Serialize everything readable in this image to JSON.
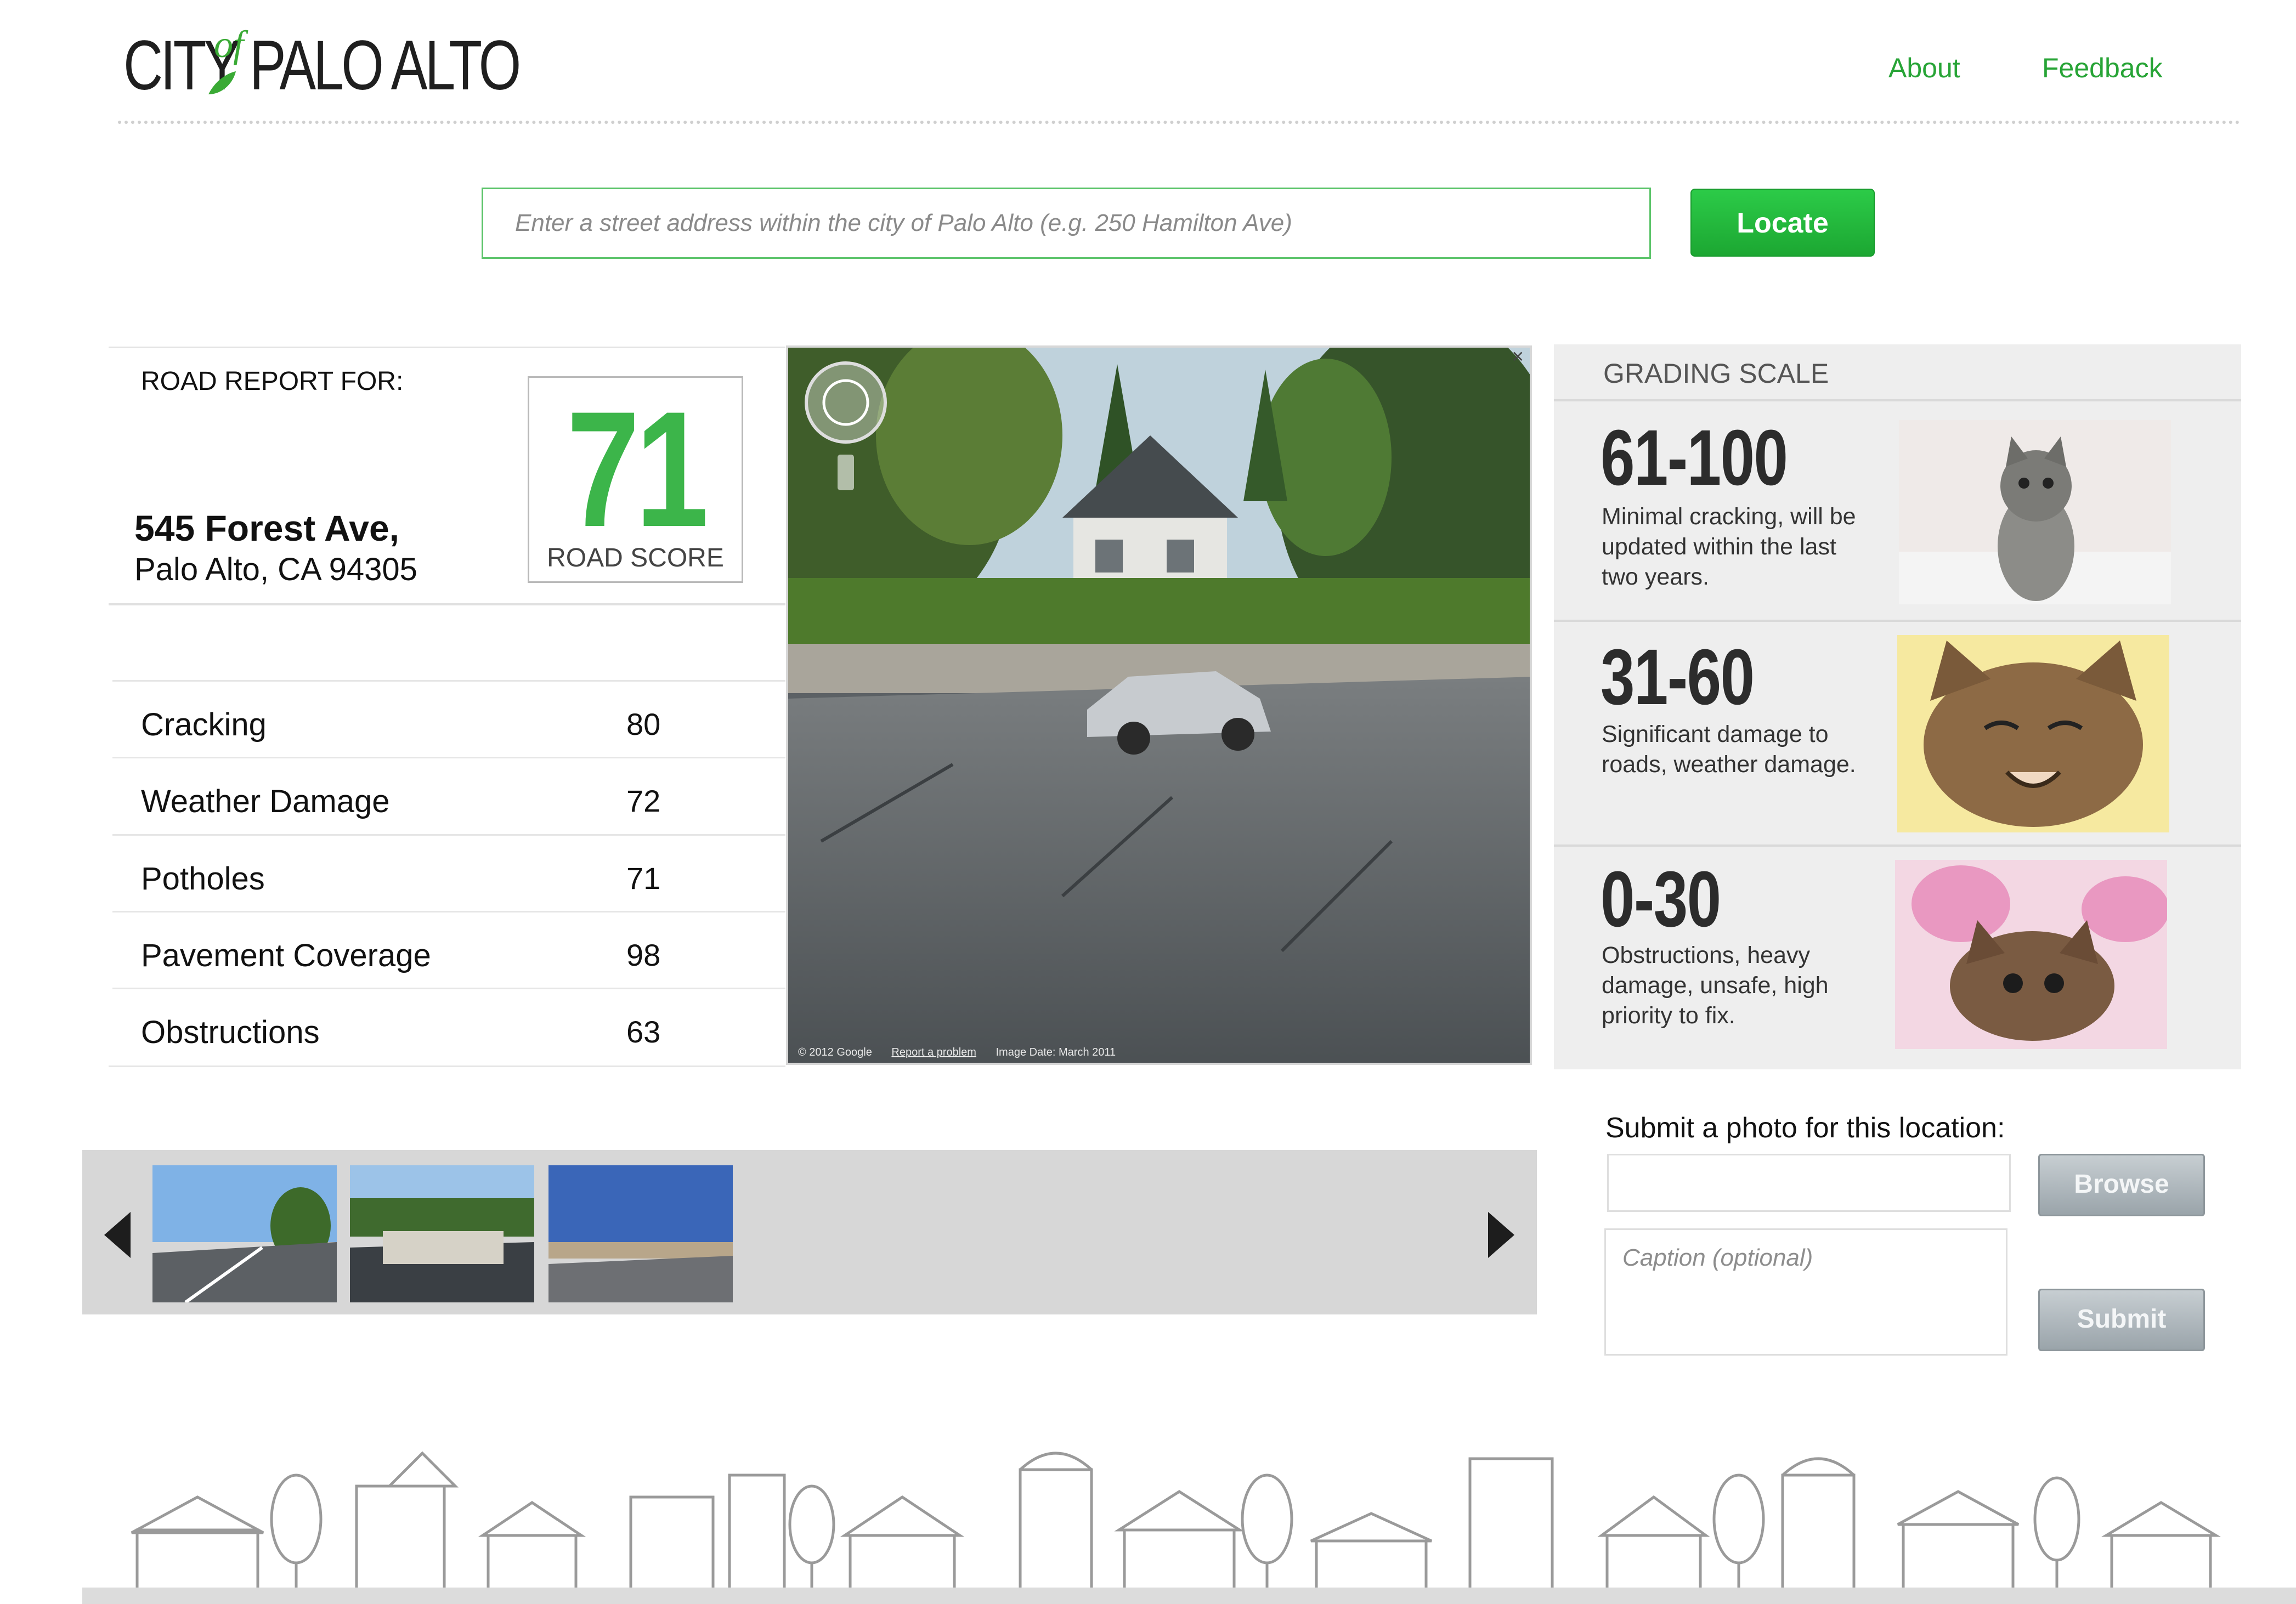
{
  "header": {
    "logo_text": "CITY of PALO ALTO",
    "logo_word_left": "CITY",
    "logo_word_of": "of",
    "logo_word_right": "PALO ALTO",
    "nav": {
      "about": "About",
      "feedback": "Feedback"
    }
  },
  "search": {
    "placeholder": "Enter a street address within the city of Palo Alto (e.g. 250 Hamilton Ave)",
    "button_label": "Locate"
  },
  "report": {
    "heading": "ROAD REPORT FOR:",
    "address_line1": "545 Forest Ave,",
    "address_line2": "Palo Alto, CA 94305",
    "score_value": "71",
    "score_label": "ROAD SCORE",
    "metrics": [
      {
        "name": "Cracking",
        "value": "80"
      },
      {
        "name": "Weather Damage",
        "value": "72"
      },
      {
        "name": "Potholes",
        "value": "71"
      },
      {
        "name": "Pavement Coverage",
        "value": "98"
      },
      {
        "name": "Obstructions",
        "value": "63"
      }
    ]
  },
  "street_view": {
    "copyright": "© 2012 Google",
    "report_link": "Report a problem",
    "image_date": "Image Date: March 2011"
  },
  "grading": {
    "title": "GRADING SCALE",
    "levels": [
      {
        "range": "61-100",
        "description": "Minimal cracking, will be updated within the last two years."
      },
      {
        "range": "31-60",
        "description": "Significant damage to roads, weather damage."
      },
      {
        "range": "0-30",
        "description": "Obstructions, heavy damage, unsafe, high priority to fix."
      }
    ]
  },
  "upload": {
    "title": "Submit a photo for this location:",
    "browse_label": "Browse",
    "caption_placeholder": "Caption (optional)",
    "submit_label": "Submit"
  },
  "colors": {
    "brand_green": "#3cb54a",
    "link_green": "#27a436",
    "button_grey": "#9aa4aa"
  }
}
